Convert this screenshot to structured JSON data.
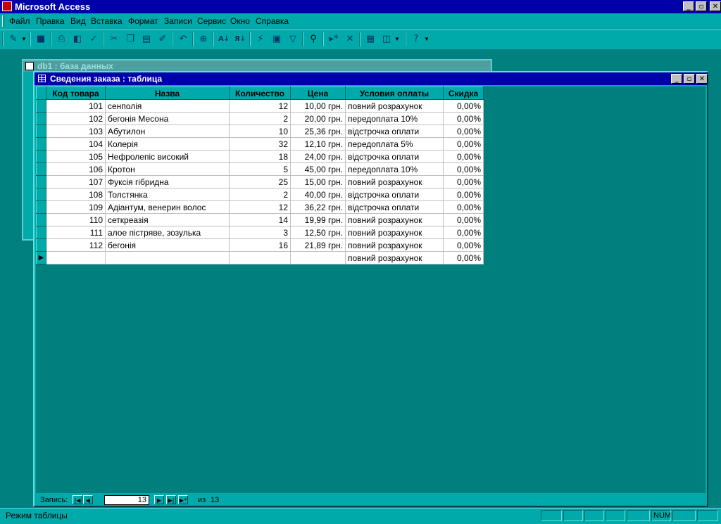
{
  "app": {
    "title": "Microsoft Access"
  },
  "window_controls": {
    "minimize": "_",
    "maximize": "▫",
    "close": "✕"
  },
  "menu": {
    "items": [
      {
        "label": "Файл"
      },
      {
        "label": "Правка"
      },
      {
        "label": "Вид"
      },
      {
        "label": "Вставка"
      },
      {
        "label": "Формат"
      },
      {
        "label": "Записи"
      },
      {
        "label": "Сервис"
      },
      {
        "label": "Окно"
      },
      {
        "label": "Справка"
      }
    ]
  },
  "toolbar": {
    "icons": [
      "design-view-icon",
      "save-icon",
      "print-icon",
      "print-preview-icon",
      "spelling-icon",
      "cut-icon",
      "copy-icon",
      "paste-icon",
      "format-painter-icon",
      "undo-icon",
      "hyperlink-icon",
      "sort-ascending-icon",
      "sort-descending-icon",
      "filter-by-selection-icon",
      "filter-by-form-icon",
      "apply-filter-icon",
      "find-icon",
      "new-record-icon",
      "delete-record-icon",
      "properties-icon",
      "new-object-icon",
      "help-icon"
    ]
  },
  "db_window": {
    "title": "db1 : база данных"
  },
  "table_window": {
    "title": "Сведения заказа : таблица",
    "columns": [
      "Код товара",
      "Назва",
      "Количество",
      "Цена",
      "Условия оплаты",
      "Скидка"
    ],
    "rows": [
      [
        "101",
        "сенполія",
        "12",
        "10,00 грн.",
        "повний розрахунок",
        "0,00%"
      ],
      [
        "102",
        "бегонія Месона",
        "2",
        "20,00 грн.",
        "передоплата 10%",
        "0,00%"
      ],
      [
        "103",
        "Абутилон",
        "10",
        "25,36 грн.",
        "відстрочка оплати",
        "0,00%"
      ],
      [
        "104",
        "Колерія",
        "32",
        "12,10 грн.",
        "передоплата 5%",
        "0,00%"
      ],
      [
        "105",
        "Нефролепіс високий",
        "18",
        "24,00 грн.",
        "відстрочка оплати",
        "0,00%"
      ],
      [
        "106",
        "Кротон",
        "5",
        "45,00 грн.",
        "передоплата 10%",
        "0,00%"
      ],
      [
        "107",
        "Фуксія гібридна",
        "25",
        "15,00 грн.",
        "повний розрахунок",
        "0,00%"
      ],
      [
        "108",
        "Толстянка",
        "2",
        "40,00 грн.",
        "відстрочка оплати",
        "0,00%"
      ],
      [
        "109",
        "Адіантум, венерин волос",
        "12",
        "36,22 грн.",
        "відстрочка оплати",
        "0,00%"
      ],
      [
        "110",
        "сеткреазія",
        "14",
        "19,99 грн.",
        "повний розрахунок",
        "0,00%"
      ],
      [
        "111",
        "алое пістряве, зозулька",
        "3",
        "12,50 грн.",
        "повний розрахунок",
        "0,00%"
      ],
      [
        "112",
        "бегонія",
        "16",
        "21,89 грн.",
        "повний розрахунок",
        "0,00%"
      ]
    ],
    "new_row": [
      "",
      "",
      "",
      "",
      "повний розрахунок",
      "0,00%"
    ]
  },
  "navigation": {
    "label": "Запись:",
    "current": "13",
    "of_label": "из",
    "total": "13"
  },
  "status": {
    "text": "Режим таблицы",
    "num": "NUM"
  }
}
